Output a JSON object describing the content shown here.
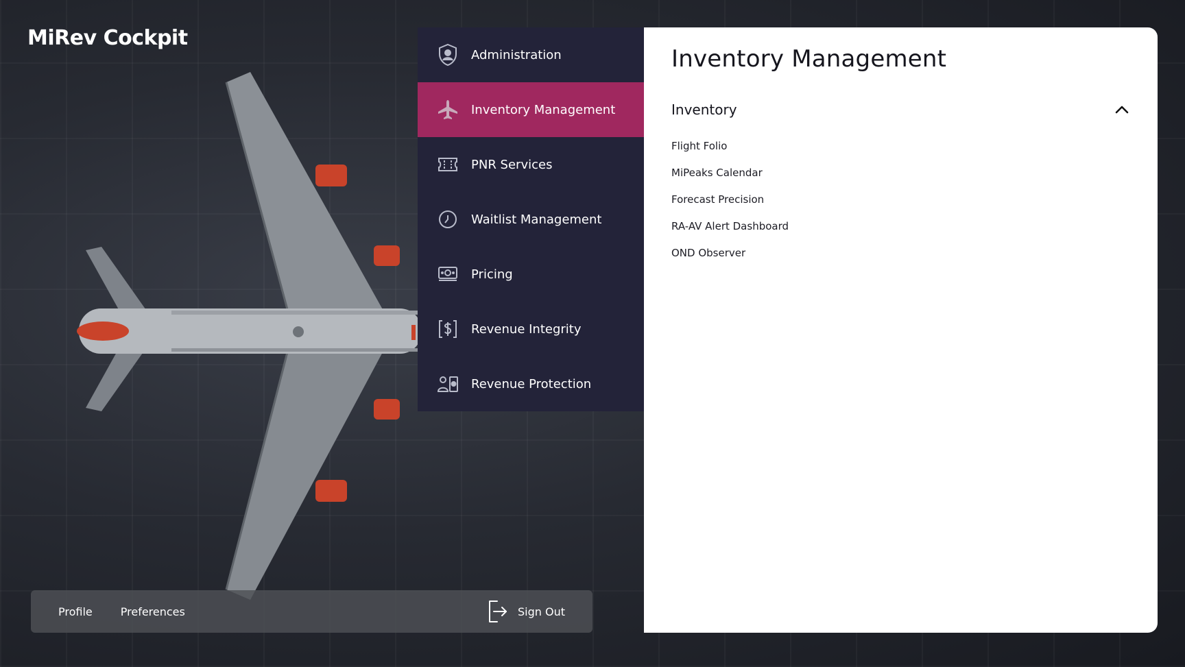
{
  "app": {
    "title": "MiRev Cockpit"
  },
  "menu": {
    "items": [
      {
        "label": "Administration",
        "icon": "shield-user-icon",
        "active": false
      },
      {
        "label": "Inventory Management",
        "icon": "airplane-icon",
        "active": true
      },
      {
        "label": "PNR Services",
        "icon": "ticket-icon",
        "active": false
      },
      {
        "label": "Waitlist Management",
        "icon": "clock-icon",
        "active": false
      },
      {
        "label": "Pricing",
        "icon": "banknote-icon",
        "active": false
      },
      {
        "label": "Revenue Integrity",
        "icon": "dollar-bracket-icon",
        "active": false
      },
      {
        "label": "Revenue Protection",
        "icon": "user-shield-icon",
        "active": false
      }
    ]
  },
  "panel": {
    "title": "Inventory Management",
    "section": {
      "title": "Inventory",
      "expanded": true,
      "items": [
        "Flight Folio",
        "MiPeaks Calendar",
        "Forecast Precision",
        "RA-AV Alert Dashboard",
        "OND Observer"
      ]
    }
  },
  "account_bar": {
    "profile": "Profile",
    "preferences": "Preferences",
    "sign_out": "Sign Out"
  },
  "colors": {
    "menu_bg": "#232339",
    "active_bg": "#a0285f",
    "panel_bg": "#ffffff",
    "engine_accent": "#c9432a"
  }
}
